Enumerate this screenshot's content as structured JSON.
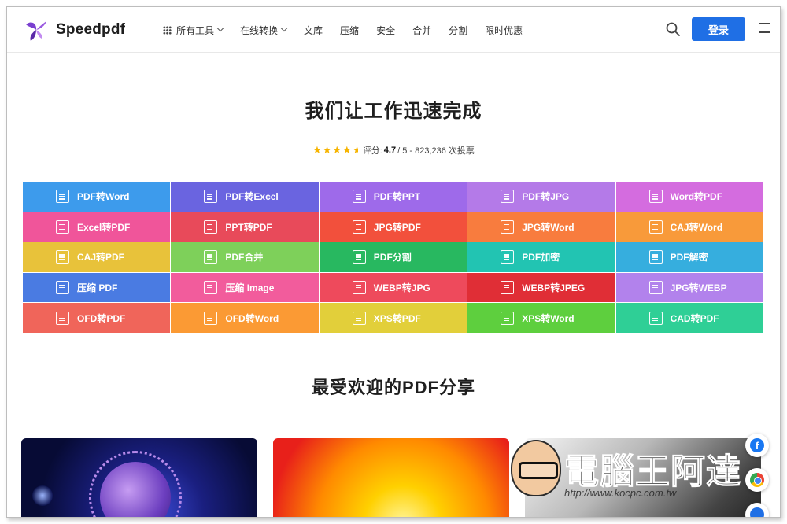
{
  "brand": {
    "name": "Speedpdf",
    "accent": "#1f6fe5"
  },
  "nav": {
    "items": [
      {
        "label": "所有工具",
        "has_dropdown": true,
        "icon": "grid-icon"
      },
      {
        "label": "在线转换",
        "has_dropdown": true
      },
      {
        "label": "文库"
      },
      {
        "label": "压缩"
      },
      {
        "label": "安全"
      },
      {
        "label": "合并"
      },
      {
        "label": "分割"
      },
      {
        "label": "限时优惠"
      }
    ],
    "login_label": "登录"
  },
  "hero": {
    "title": "我们让工作迅速完成",
    "rating_prefix": "评分:",
    "rating_value": "4.7",
    "rating_suffix": "/ 5 - 823,236 次投票",
    "stars": 4.5
  },
  "tools": [
    {
      "label": "PDF转Word",
      "color": "#3d9bec"
    },
    {
      "label": "PDF转Excel",
      "color": "#6a64e0"
    },
    {
      "label": "PDF转PPT",
      "color": "#9e6aea"
    },
    {
      "label": "PDF转JPG",
      "color": "#b47ae8"
    },
    {
      "label": "Word转PDF",
      "color": "#d46cdf"
    },
    {
      "label": "Excel转PDF",
      "color": "#f0559a"
    },
    {
      "label": "PPT转PDF",
      "color": "#e84a5a"
    },
    {
      "label": "JPG转PDF",
      "color": "#f2503c"
    },
    {
      "label": "JPG转Word",
      "color": "#f87c3e"
    },
    {
      "label": "CAJ转Word",
      "color": "#f89a3a"
    },
    {
      "label": "CAJ转PDF",
      "color": "#e8c23a"
    },
    {
      "label": "PDF合并",
      "color": "#7ed05a"
    },
    {
      "label": "PDF分割",
      "color": "#28b860"
    },
    {
      "label": "PDF加密",
      "color": "#22c4b2"
    },
    {
      "label": "PDF解密",
      "color": "#36aede"
    },
    {
      "label": "压缩 PDF",
      "color": "#4a7be2"
    },
    {
      "label": "压缩 Image",
      "color": "#f25c9c"
    },
    {
      "label": "WEBP转JPG",
      "color": "#ee4a5c"
    },
    {
      "label": "WEBP转JPEG",
      "color": "#e02e36"
    },
    {
      "label": "JPG转WEBP",
      "color": "#b282ec"
    },
    {
      "label": "OFD转PDF",
      "color": "#f0655a"
    },
    {
      "label": "OFD转Word",
      "color": "#fb9a34"
    },
    {
      "label": "XPS转PDF",
      "color": "#e2cf3a"
    },
    {
      "label": "XPS转Word",
      "color": "#5ecf3e"
    },
    {
      "label": "CAD转PDF",
      "color": "#2fcf96"
    }
  ],
  "popular": {
    "title": "最受欢迎的PDF分享"
  },
  "watermark": {
    "text": "電腦王阿達",
    "url": "http://www.kocpc.com.tw"
  },
  "social": {
    "fb_label": "f"
  }
}
